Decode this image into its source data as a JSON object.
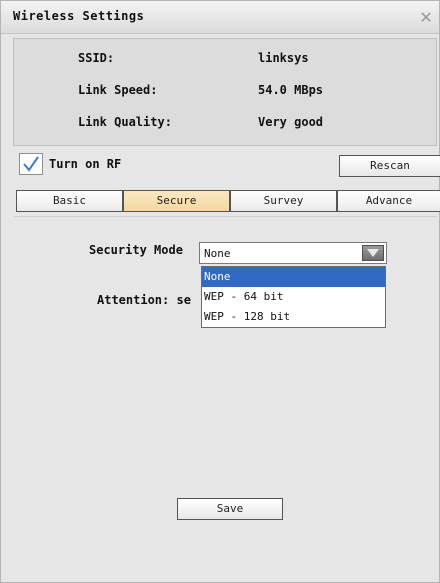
{
  "window": {
    "title": "Wireless Settings"
  },
  "info": {
    "rows": [
      {
        "label": "SSID:",
        "value": "linksys"
      },
      {
        "label": "Link Speed:",
        "value": "54.0 MBps"
      },
      {
        "label": "Link Quality:",
        "value": "Very good"
      }
    ]
  },
  "rf": {
    "label": "Turn on RF",
    "checked": true
  },
  "rescan_label": "Rescan",
  "tabs": [
    {
      "label": "Basic"
    },
    {
      "label": "Secure",
      "active": true
    },
    {
      "label": "Survey"
    },
    {
      "label": "Advance"
    }
  ],
  "secure": {
    "mode_label": "Security Mode",
    "selected": "None",
    "options": [
      "None",
      "WEP - 64 bit",
      "WEP - 128 bit"
    ],
    "attention_partial": "Attention: se"
  },
  "save_label": "Save",
  "icons": {
    "close": "close-icon",
    "check": "check-icon",
    "dropdown": "chevron-down-icon"
  },
  "colors": {
    "selection": "#316ac5",
    "active_tab": "#f3d89f"
  }
}
